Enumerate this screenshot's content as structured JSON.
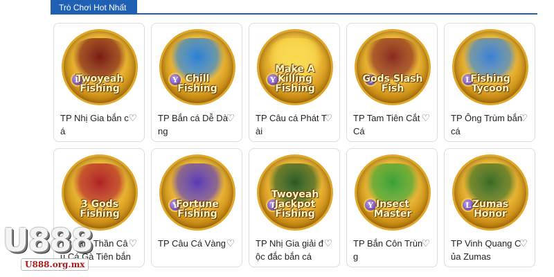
{
  "section": {
    "title": "Trò Chơi Hot Nhất"
  },
  "games": [
    {
      "title": "TP Nhị Gia bắn cá",
      "logo": "Twoyeah Fishing",
      "badge": "L",
      "accent": "#7a1a10"
    },
    {
      "title": "TP Bắn cá Dễ Dàng",
      "logo": "Chill Fishing",
      "badge": "Y",
      "accent": "#2a7fd4"
    },
    {
      "title": "TP Câu cá Phát Tài",
      "logo": "Make A Killing Fishing",
      "badge": "Y",
      "accent": "#f7d84a"
    },
    {
      "title": "TP Tam Tiên Cắt Cá",
      "logo": "Gods Slash Fish",
      "badge": "D",
      "accent": "#8a2a1a"
    },
    {
      "title": "TP Ông Trùm bắn cá",
      "logo": "Fishing Tycoon",
      "badge": "L",
      "accent": "#3a7fd0"
    },
    {
      "title": "TP Tam Thần Câu Cá Gà Tiên bắn cá",
      "logo": "3 Gods Fishing",
      "badge": "",
      "accent": "#b02020"
    },
    {
      "title": "TP Câu Cá Vàng",
      "logo": "Fortune Fishing",
      "badge": "Y",
      "accent": "#5a3ab0"
    },
    {
      "title": "TP Nhị Gia giải độc đắc bắn cá",
      "logo": "Twoyeah Jackpot Fishing",
      "badge": "T",
      "accent": "#2a5a20"
    },
    {
      "title": "TP Bắn Côn Trùng",
      "logo": "Insect Master",
      "badge": "Y",
      "accent": "#3aa030"
    },
    {
      "title": "TP Vinh Quang Của Zumas",
      "logo": "Zumas Honor",
      "badge": "L",
      "accent": "#3a6a20"
    }
  ],
  "watermark": {
    "brand": "U888",
    "url": "U888.org.mx"
  }
}
